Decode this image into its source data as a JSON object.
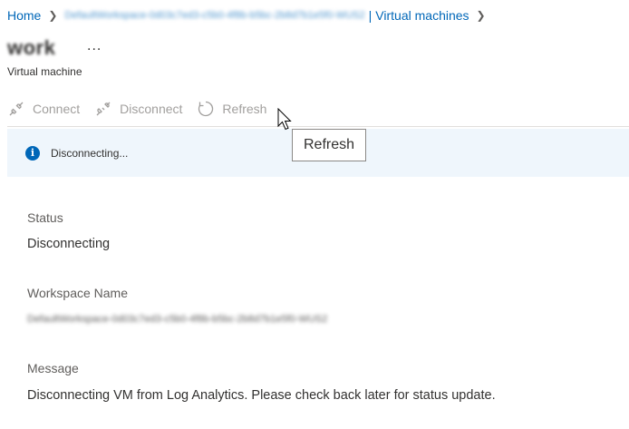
{
  "breadcrumb": {
    "home": "Home",
    "workspace": "DefaultWorkspace-0d03c7ed3-c5b0-4f8b-b5bc-2b8d7b1e5f0-WUS2",
    "pipe": "|",
    "virtual_machines": "Virtual machines"
  },
  "header": {
    "title": "work",
    "more": "...",
    "subtitle": "Virtual machine"
  },
  "toolbar": {
    "connect": "Connect",
    "disconnect": "Disconnect",
    "refresh": "Refresh"
  },
  "tooltip": {
    "text": "Refresh"
  },
  "infobar": {
    "icon": "info-icon",
    "text": "Disconnecting..."
  },
  "fields": {
    "status_label": "Status",
    "status_value": "Disconnecting",
    "workspace_label": "Workspace Name",
    "workspace_value": "DefaultWorkspace-0d03c7ed3-c5b0-4f8b-b5bc-2b8d7b1e5f0-WUS2",
    "message_label": "Message",
    "message_value": "Disconnecting VM from Log Analytics. Please check back later for status update."
  },
  "colors": {
    "link": "#0067b8",
    "info_bg": "#eff6fc",
    "disabled": "#a19f9d"
  }
}
